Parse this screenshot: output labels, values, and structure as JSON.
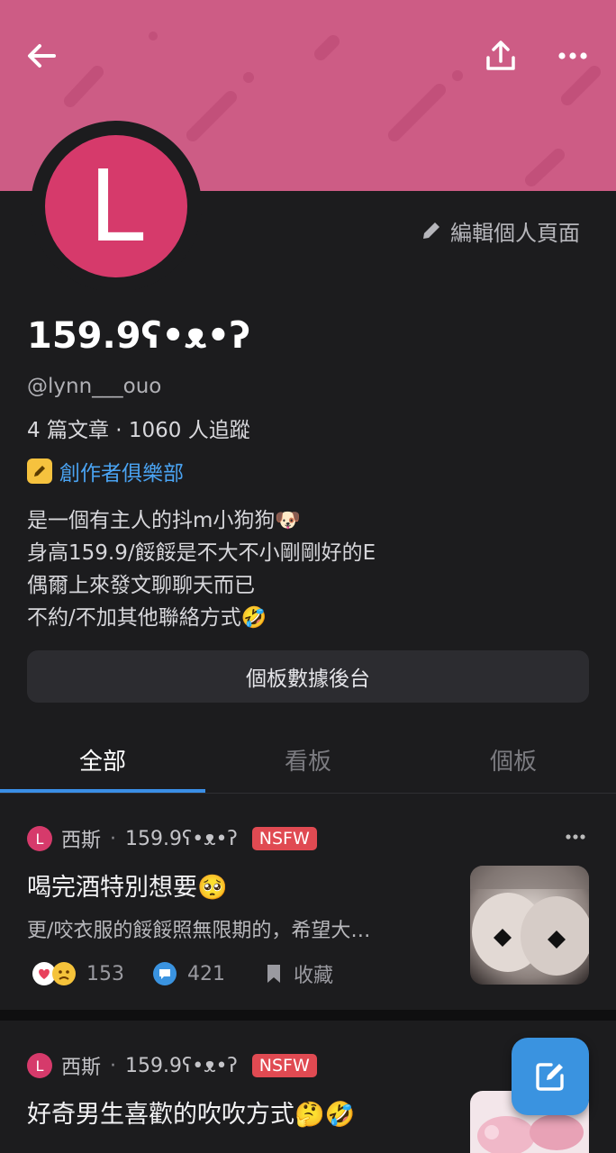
{
  "header": {
    "back_icon": "arrow-left-icon",
    "share_icon": "share-upload-icon",
    "more_icon": "ellipsis-icon",
    "banner_color": "#cd5c85"
  },
  "profile": {
    "avatar_letter": "L",
    "avatar_color": "#d63a6b",
    "edit_label": "編輯個人頁面",
    "name": "159.9ʕ•ᴥ•ʔ",
    "handle": "@lynn___ouo",
    "stats": "4 篇文章 · 1060 人追蹤",
    "club": "創作者俱樂部",
    "bio": [
      "是一個有主人的抖m小狗狗🐶",
      "身高159.9/餒餒是不大不小剛剛好的E",
      "偶爾上來發文聊聊天而已",
      "不約/不加其他聯絡方式🤣"
    ],
    "dashboard_button": "個板數據後台"
  },
  "tabs": [
    {
      "label": "全部",
      "active": true
    },
    {
      "label": "看板",
      "active": false
    },
    {
      "label": "個板",
      "active": false
    }
  ],
  "posts": [
    {
      "avatar_letter": "L",
      "board": "西斯",
      "author": "159.9ʕ•ᴥ•ʔ",
      "tag": "NSFW",
      "title": "喝完酒特別想要🥺",
      "excerpt": "更/咬衣服的餒餒照無限期的，希望大…",
      "reactions": "153",
      "comments": "421",
      "save_label": "收藏"
    },
    {
      "avatar_letter": "L",
      "board": "西斯",
      "author": "159.9ʕ•ᴥ•ʔ",
      "tag": "NSFW",
      "title": "好奇男生喜歡的吹吹方式🤔🤣"
    }
  ],
  "fab_icon": "compose-edit-icon",
  "accent_color": "#3a8ee6"
}
